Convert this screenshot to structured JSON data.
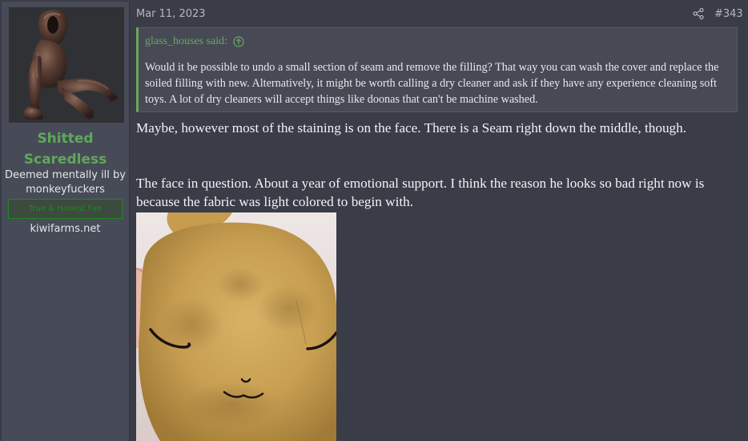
{
  "user": {
    "name": "Shitted Scaredless",
    "title": "Deemed mentally ill by monkeyfuckers",
    "banner": "True & Honest Fan",
    "extra": "kiwifarms.net"
  },
  "post": {
    "date": "Mar 11, 2023",
    "number": "#343",
    "quote": {
      "author_label": "glass_houses said:",
      "text": "Would it be possible to undo a small section of seam and remove the filling? That way you can wash the cover and replace the soiled filling with new. Alternatively, it might be worth calling a dry cleaner and ask if they have any experience cleaning soft toys. A lot of dry cleaners will accept things like doonas that can't be machine washed."
    },
    "paragraphs": [
      "Maybe, however most of the staining is on the face. There is a Seam right down the middle, though.",
      "The face in question. About a year of emotional support. I think the reason he looks so bad right now is because the fabric was light colored to begin with."
    ]
  },
  "icons": {
    "share": "share-icon",
    "quote_jump": "arrow-up-circle-icon"
  },
  "colors": {
    "username": "#5fa85a",
    "quote_accent": "#6aa761",
    "banner_border": "#1e8a1e",
    "background": "#3a3d47",
    "sidebar": "#474b57"
  }
}
